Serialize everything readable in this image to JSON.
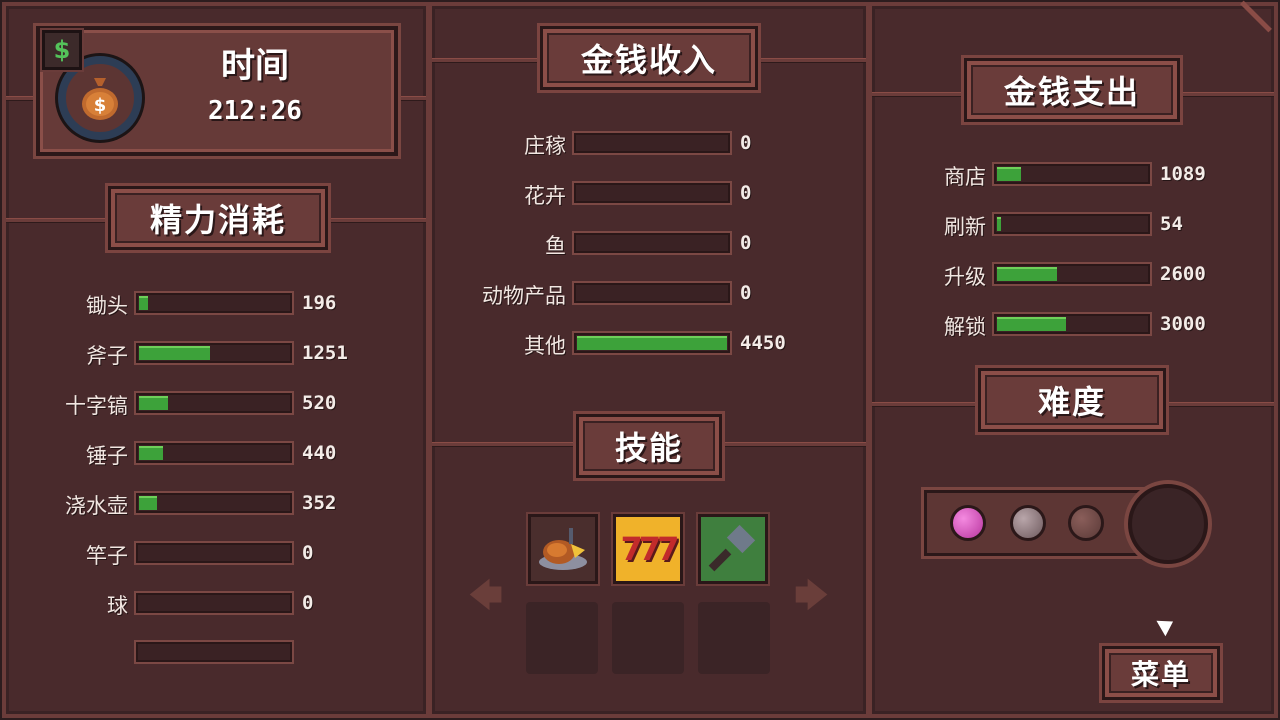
{
  "time": {
    "title": "时间",
    "value": "212:26"
  },
  "energy": {
    "title": "精力消耗",
    "items": [
      {
        "label": "锄头",
        "value": "196",
        "pct": 0.06
      },
      {
        "label": "斧子",
        "value": "1251",
        "pct": 0.47
      },
      {
        "label": "十字镐",
        "value": "520",
        "pct": 0.19
      },
      {
        "label": "锤子",
        "value": "440",
        "pct": 0.16
      },
      {
        "label": "浇水壶",
        "value": "352",
        "pct": 0.12
      },
      {
        "label": "竿子",
        "value": "0",
        "pct": 0
      },
      {
        "label": "球",
        "value": "0",
        "pct": 0
      }
    ]
  },
  "income": {
    "title": "金钱收入",
    "items": [
      {
        "label": "庄稼",
        "value": "0",
        "pct": 0
      },
      {
        "label": "花卉",
        "value": "0",
        "pct": 0
      },
      {
        "label": "鱼",
        "value": "0",
        "pct": 0
      },
      {
        "label": "动物产品",
        "value": "0",
        "pct": 0
      },
      {
        "label": "其他",
        "value": "4450",
        "pct": 1.0
      }
    ]
  },
  "expense": {
    "title": "金钱支出",
    "items": [
      {
        "label": "商店",
        "value": "1089",
        "pct": 0.16
      },
      {
        "label": "刷新",
        "value": "54",
        "pct": 0.02
      },
      {
        "label": "升级",
        "value": "2600",
        "pct": 0.4
      },
      {
        "label": "解锁",
        "value": "3000",
        "pct": 0.46
      }
    ]
  },
  "skills": {
    "title": "技能"
  },
  "difficulty": {
    "title": "难度"
  },
  "menu": {
    "label": "菜单"
  },
  "icons": {
    "currency": "dollar-sign-icon",
    "money_bag": "money-bag-icon",
    "skill_1": "roast-chicken-icon",
    "skill_2": "slot-777-icon",
    "skill_3": "hammer-icon",
    "left": "arrow-left-icon",
    "right": "arrow-right-icon"
  },
  "colors": {
    "bar_fill": "#3da23a",
    "panel": "#492a2c",
    "border": "#6b3c3a"
  }
}
